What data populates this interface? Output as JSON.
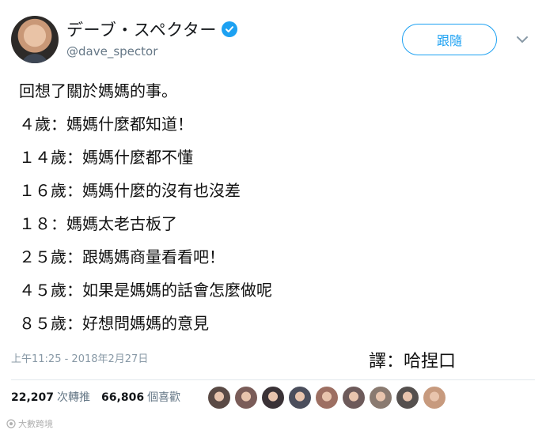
{
  "profile": {
    "display_name": "デーブ・スペクター",
    "handle": "@dave_spector",
    "follow_label": "跟隨",
    "avatar_icon": "user-avatar-photo",
    "verified_icon": "verified-badge-icon"
  },
  "tweet": {
    "lines": [
      "回想了關於媽媽的事。",
      "４歲：媽媽什麼都知道！",
      "１４歲：媽媽什麼都不懂",
      "１６歲：媽媽什麼的沒有也沒差",
      "１８：媽媽太老古板了",
      "２５歲：跟媽媽商量看看吧！",
      "４５歲：如果是媽媽的話會怎麼做呢",
      "８５歲：好想問媽媽的意見"
    ],
    "timestamp": "上午11:25 - 2018年2月27日",
    "translator_note": "譯：哈捏口"
  },
  "stats": {
    "retweets_count": "22,207",
    "retweets_label": "次轉推",
    "likes_count": "66,806",
    "likes_label": "個喜歡"
  },
  "likers": {
    "colors": [
      "#5a4a45",
      "#7a5c58",
      "#3a3236",
      "#4b4e5c",
      "#9d6f62",
      "#6d5a5a",
      "#8a7a70",
      "#55504e",
      "#c79a7e"
    ]
  },
  "watermark": {
    "text": "大數跨境"
  },
  "colors": {
    "accent": "#1da1f2",
    "muted": "#657786"
  }
}
